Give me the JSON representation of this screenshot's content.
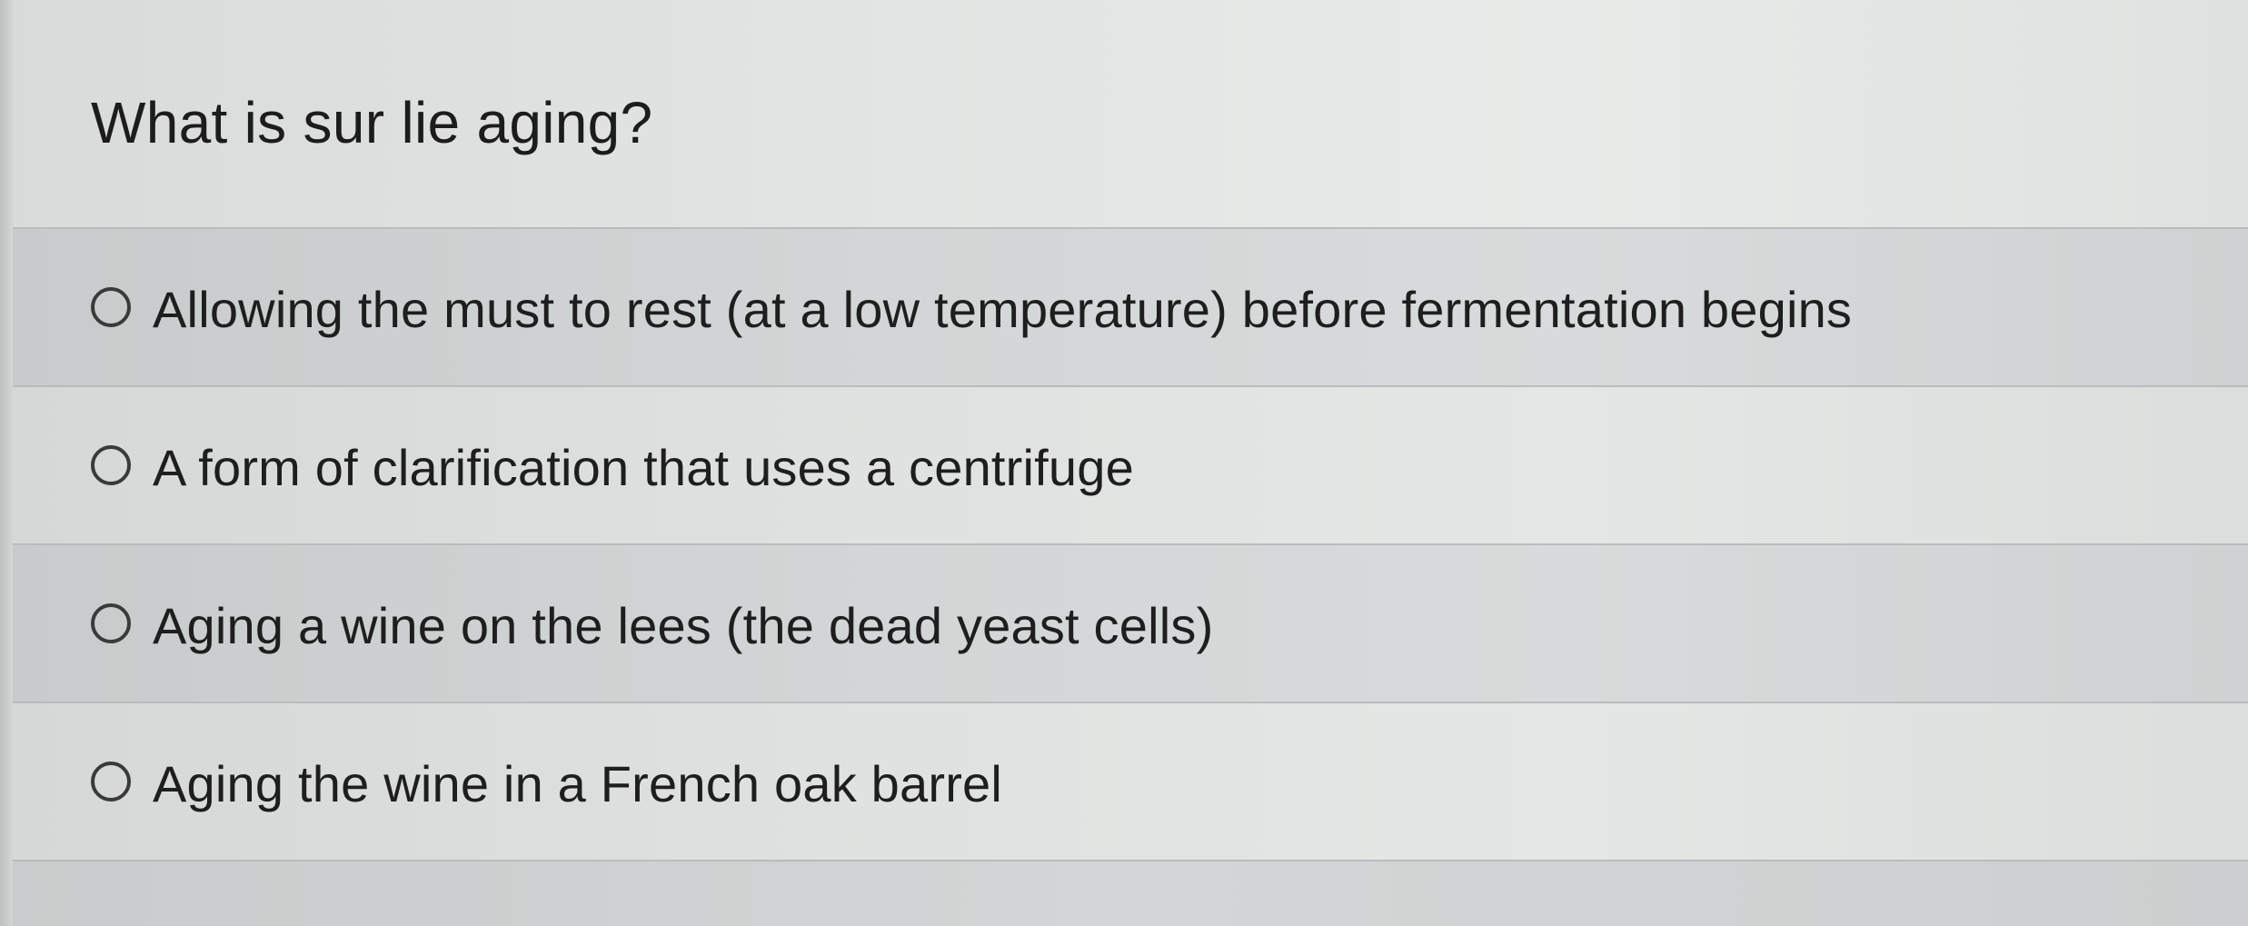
{
  "question": {
    "text": "What is sur lie aging?"
  },
  "options": [
    {
      "label": "Allowing the must to rest (at a low temperature) before fermentation begins",
      "selected": false
    },
    {
      "label": "A form of clarification that uses a centrifuge",
      "selected": false
    },
    {
      "label": "Aging a wine on the lees (the dead yeast cells)",
      "selected": false
    },
    {
      "label": "Aging the wine in a French oak barrel",
      "selected": false
    }
  ]
}
